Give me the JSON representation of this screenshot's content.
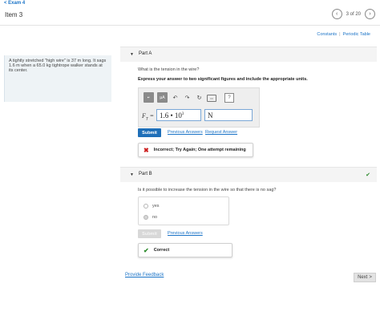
{
  "header": {
    "back_label": "< Exam 4",
    "item_title": "Item 3",
    "prev_icon": "chevron-left-icon",
    "next_icon": "chevron-right-icon",
    "pager_text": "3 of 20"
  },
  "resources": {
    "constants": "Constants",
    "separator": "|",
    "periodic_table": "Periodic Table"
  },
  "problem": {
    "text": "A tightly stretched \"high wire\" is 37 m long. It sags 1.6 m when a 65.0 kg tightrope walker stands at its center."
  },
  "part_a": {
    "label": "Part A",
    "question": "What is the tension in the wire?",
    "instruction": "Express your answer to two significant figures and include the appropriate units.",
    "toolbar": {
      "templates_label": "▪▫",
      "units_label": "μA",
      "help_label": "?",
      "undo_icon": "undo-icon",
      "redo_icon": "redo-icon",
      "reset_icon": "reset-icon",
      "keyboard_label": "kbd"
    },
    "variable": "F",
    "variable_sub": "T",
    "equals": "=",
    "value_mantissa": "1.6 • 10",
    "value_exp": "3",
    "unit_value": "N",
    "submit_label": "Submit",
    "previous_answers": "Previous Answers",
    "request_answer": "Request Answer",
    "feedback": "Incorrect; Try Again; One attempt remaining"
  },
  "part_b": {
    "label": "Part B",
    "status_icon": "check-icon",
    "question": "Is it possible to increase the tension in the wire so that there is no sag?",
    "options": [
      "yes",
      "no"
    ],
    "selected": "no",
    "submit_label": "Submit",
    "previous_answers": "Previous Answers",
    "feedback": "Correct"
  },
  "footer": {
    "provide_feedback": "Provide Feedback",
    "next_label": "Next",
    "next_arrow": ">"
  },
  "colors": {
    "link": "#1a73c7",
    "submit": "#1f6fb8",
    "incorrect": "#cc1f1f",
    "correct": "#2e8b2e"
  }
}
